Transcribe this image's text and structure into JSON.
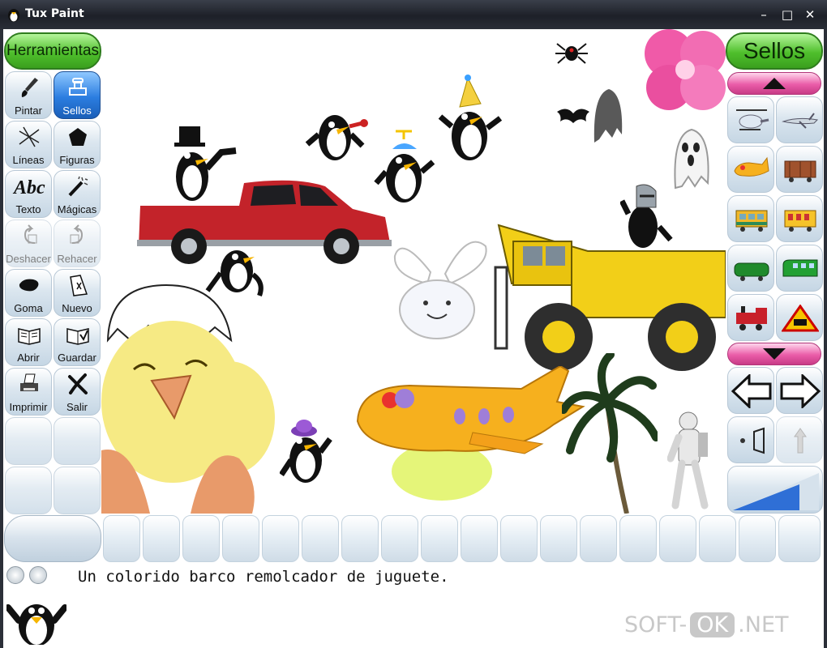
{
  "window": {
    "title": "Tux Paint",
    "controls": [
      "–",
      "□",
      "✕"
    ]
  },
  "tools": {
    "header": "Herramientas",
    "items": [
      {
        "label": "Pintar",
        "icon": "brush-icon",
        "active": false
      },
      {
        "label": "Sellos",
        "icon": "stamp-icon",
        "active": true
      },
      {
        "label": "Líneas",
        "icon": "lines-icon",
        "active": false
      },
      {
        "label": "Figuras",
        "icon": "pentagon-icon",
        "active": false
      },
      {
        "label": "Texto",
        "icon": "text-icon",
        "active": false
      },
      {
        "label": "Mágicas",
        "icon": "magic-wand-icon",
        "active": false
      },
      {
        "label": "Deshacer",
        "icon": "undo-icon",
        "active": false
      },
      {
        "label": "Rehacer",
        "icon": "redo-icon",
        "active": false
      },
      {
        "label": "Goma",
        "icon": "eraser-icon",
        "active": false
      },
      {
        "label": "Nuevo",
        "icon": "new-page-icon",
        "active": false
      },
      {
        "label": "Abrir",
        "icon": "open-book-icon",
        "active": false
      },
      {
        "label": "Guardar",
        "icon": "save-book-icon",
        "active": false
      },
      {
        "label": "Imprimir",
        "icon": "printer-icon",
        "active": false
      },
      {
        "label": "Salir",
        "icon": "exit-icon",
        "active": false
      }
    ]
  },
  "stamps": {
    "header": "Sellos",
    "items": [
      {
        "icon": "helicopter-icon"
      },
      {
        "icon": "airliner-icon"
      },
      {
        "icon": "toy-plane-icon"
      },
      {
        "icon": "boxcar-icon"
      },
      {
        "icon": "passenger-car-icon"
      },
      {
        "icon": "yellow-coach-icon"
      },
      {
        "icon": "green-locomotive-icon"
      },
      {
        "icon": "green-train-icon"
      },
      {
        "icon": "red-locomotive-icon"
      },
      {
        "icon": "train-warning-sign-icon"
      }
    ],
    "controls": [
      {
        "icon": "arrow-left-icon"
      },
      {
        "icon": "arrow-right-icon"
      },
      {
        "icon": "sound-speaker-icon"
      },
      {
        "icon": "arrow-up-icon"
      }
    ]
  },
  "status": {
    "message": "Un colorido barco remolcador de juguete."
  },
  "watermark": {
    "prefix": "SOFT-",
    "badge": "OK",
    "suffix": ".NET"
  },
  "colors": {
    "tool_header": "#4fbf2c",
    "active_tool": "#2b7de0",
    "scroll_pill": "#ea5ca8"
  }
}
